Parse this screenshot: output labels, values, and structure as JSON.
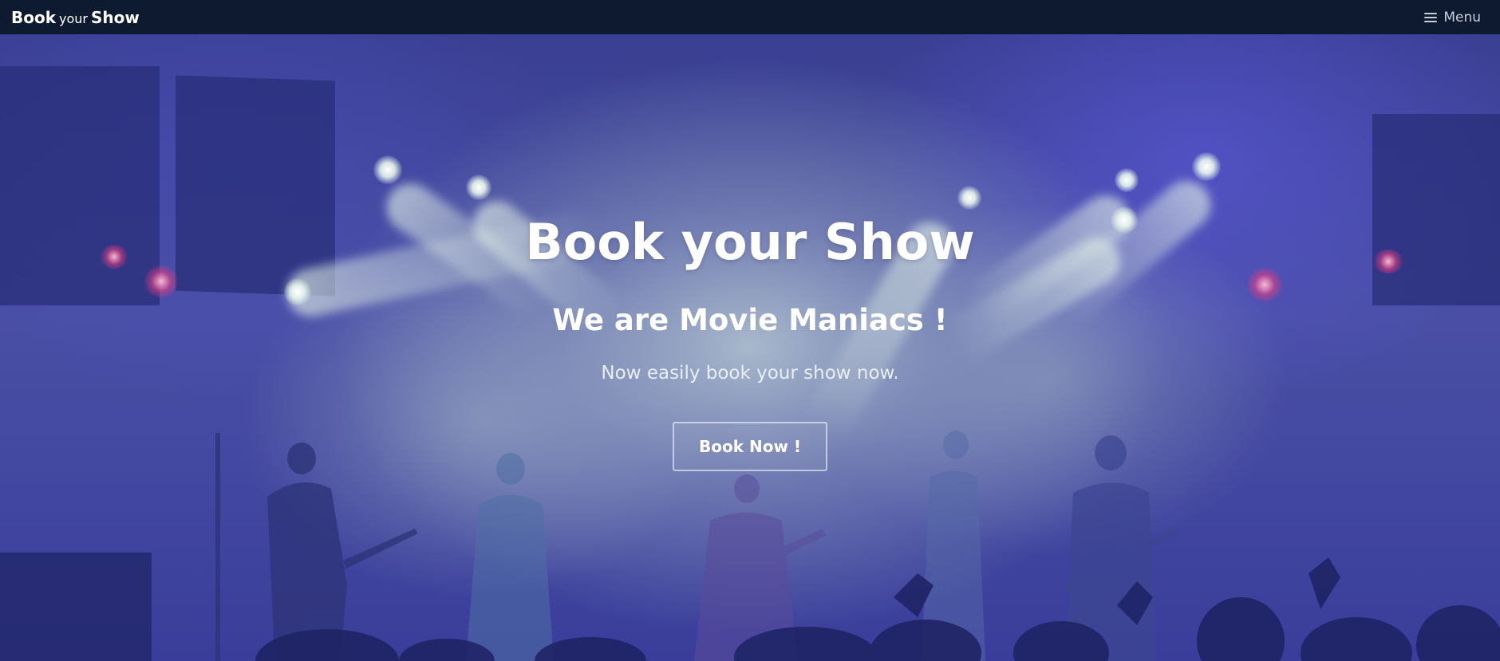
{
  "navbar": {
    "brand": {
      "part1": "Book",
      "part2": "your",
      "part3": "Show"
    },
    "menu_label": "Menu",
    "menu_icon": "hamburger-icon"
  },
  "hero": {
    "title": "Book your Show",
    "subtitle": "We are Movie Maniacs !",
    "text": "Now easily book your show now.",
    "button_label": "Book Now !",
    "background_image": "concert-stage-with-spotlights-photo"
  },
  "colors": {
    "navbar_bg": "#0d1a2f",
    "text_primary": "#ffffff",
    "menu_text": "#c9cfda",
    "hero_tint": "#4a4fa5"
  }
}
